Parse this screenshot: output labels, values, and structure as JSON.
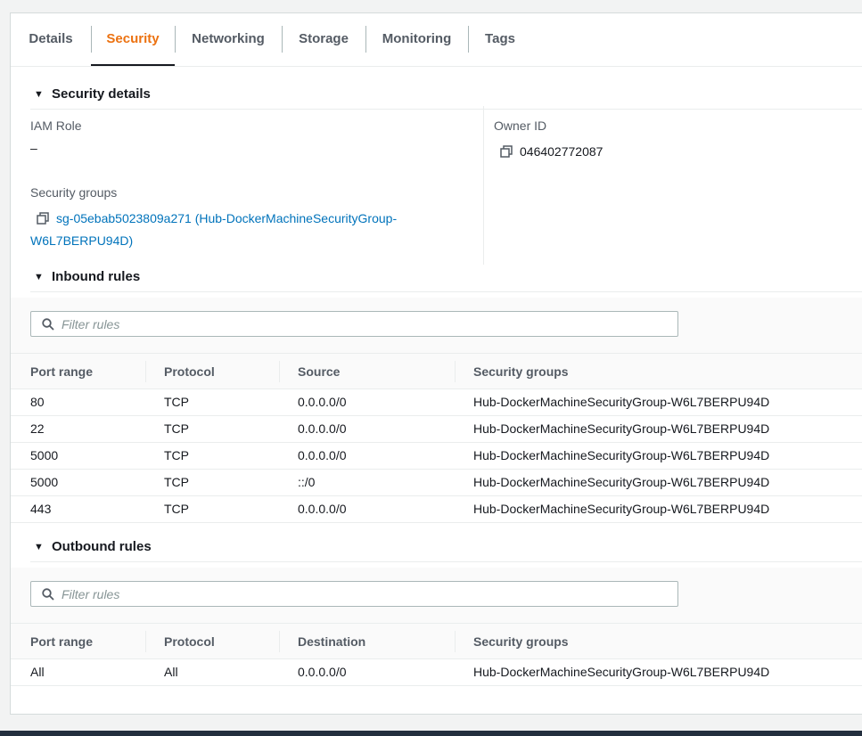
{
  "tabs": [
    {
      "label": "Details"
    },
    {
      "label": "Security"
    },
    {
      "label": "Networking"
    },
    {
      "label": "Storage"
    },
    {
      "label": "Monitoring"
    },
    {
      "label": "Tags"
    }
  ],
  "active_tab": "Security",
  "security_details": {
    "title": "Security details",
    "iam_role_label": "IAM Role",
    "iam_role_value": "–",
    "owner_id_label": "Owner ID",
    "owner_id_value": "046402772087",
    "security_groups_label": "Security groups",
    "security_group_link_line1": "sg-05ebab5023809a271 (Hub-DockerMachineSecurityGroup-",
    "security_group_link_line2": "W6L7BERPU94D)"
  },
  "inbound": {
    "title": "Inbound rules",
    "filter_placeholder": "Filter rules",
    "columns": [
      "Port range",
      "Protocol",
      "Source",
      "Security groups"
    ],
    "rows": [
      [
        "80",
        "TCP",
        "0.0.0.0/0",
        "Hub-DockerMachineSecurityGroup-W6L7BERPU94D"
      ],
      [
        "22",
        "TCP",
        "0.0.0.0/0",
        "Hub-DockerMachineSecurityGroup-W6L7BERPU94D"
      ],
      [
        "5000",
        "TCP",
        "0.0.0.0/0",
        "Hub-DockerMachineSecurityGroup-W6L7BERPU94D"
      ],
      [
        "5000",
        "TCP",
        "::/0",
        "Hub-DockerMachineSecurityGroup-W6L7BERPU94D"
      ],
      [
        "443",
        "TCP",
        "0.0.0.0/0",
        "Hub-DockerMachineSecurityGroup-W6L7BERPU94D"
      ]
    ]
  },
  "outbound": {
    "title": "Outbound rules",
    "filter_placeholder": "Filter rules",
    "columns": [
      "Port range",
      "Protocol",
      "Destination",
      "Security groups"
    ],
    "rows": [
      [
        "All",
        "All",
        "0.0.0.0/0",
        "Hub-DockerMachineSecurityGroup-W6L7BERPU94D"
      ]
    ]
  },
  "icons": {
    "copy": "copy-icon",
    "search": "search-icon",
    "caret": "caret-down-icon"
  },
  "colors": {
    "active_tab": "#ec7211",
    "link": "#0073bb",
    "text": "#16191f",
    "muted": "#545b64"
  }
}
